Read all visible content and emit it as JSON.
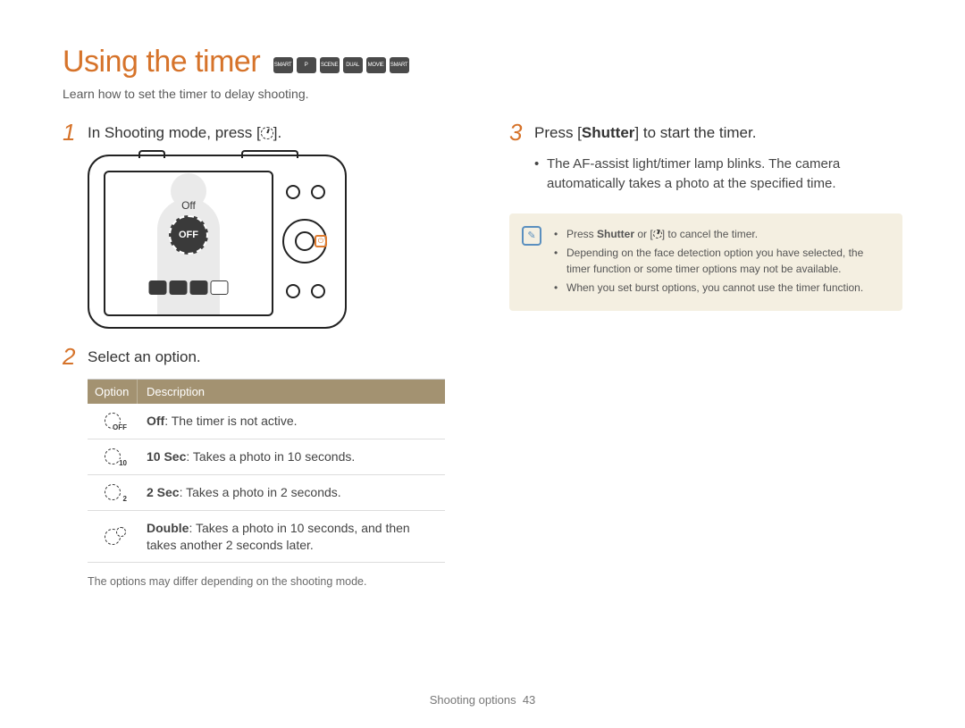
{
  "title": "Using the timer",
  "mode_icons": [
    "SMART",
    "P",
    "SCENE",
    "DUAL",
    "MOVIE",
    "SMART"
  ],
  "subtitle": "Learn how to set the timer to delay shooting.",
  "left": {
    "step1": {
      "num": "1",
      "text_a": "In Shooting mode, press [",
      "text_b": "]."
    },
    "screen": {
      "label": "Off",
      "badge": "OFF"
    },
    "step2": {
      "num": "2",
      "text": "Select an option."
    },
    "table": {
      "headers": {
        "option": "Option",
        "description": "Description"
      },
      "rows": [
        {
          "sub": "OFF",
          "bold": "Off",
          "desc": ": The timer is not active."
        },
        {
          "sub": "10",
          "bold": "10 Sec",
          "desc": ": Takes a photo in 10 seconds."
        },
        {
          "sub": "2",
          "bold": "2 Sec",
          "desc": ": Takes a photo in 2 seconds."
        },
        {
          "sub": "",
          "bold": "Double",
          "desc": ": Takes a photo in 10 seconds, and then takes another 2 seconds later."
        }
      ]
    },
    "footnote": "The options may differ depending on the shooting mode."
  },
  "right": {
    "step3": {
      "num": "3",
      "text_a": "Press [",
      "shutter": "Shutter",
      "text_b": "] to start the timer."
    },
    "bullets": [
      "The AF-assist light/timer lamp blinks. The camera automatically takes a photo at the specified time."
    ],
    "note_icon": "✎",
    "notes": [
      {
        "pre": "Press ",
        "bold": "Shutter",
        "mid": " or [",
        "post": "] to cancel the timer."
      },
      {
        "text": "Depending on the face detection option you have selected, the timer function or some timer options may not be available."
      },
      {
        "text": "When you set burst options, you cannot use the timer function."
      }
    ]
  },
  "footer": {
    "section": "Shooting options",
    "page": "43"
  }
}
